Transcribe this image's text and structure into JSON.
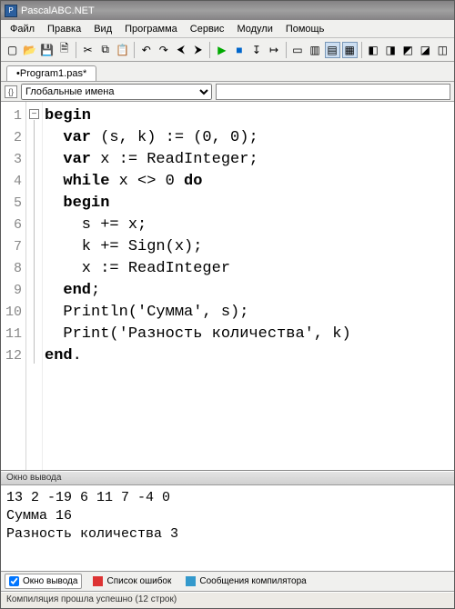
{
  "title": "PascalABC.NET",
  "menu": [
    "Файл",
    "Правка",
    "Вид",
    "Программа",
    "Сервис",
    "Модули",
    "Помощь"
  ],
  "tab": {
    "label": "•Program1.pas*"
  },
  "scope": {
    "selected": "Глобальные имена",
    "search": ""
  },
  "code": {
    "lines": [
      "begin",
      "  var (s, k) := (0, 0);",
      "  var x := ReadInteger;",
      "  while x <> 0 do",
      "  begin",
      "    s += x;",
      "    k += Sign(x);",
      "    x := ReadInteger",
      "  end;",
      "  Println('Сумма', s);",
      "  Print('Разность количества', k)",
      "end."
    ]
  },
  "output": {
    "title": "Окно вывода",
    "lines": [
      "13 2 -19 6 11 7 -4 0",
      "Сумма 16",
      "Разность количества 3"
    ]
  },
  "bottomTabs": [
    "Окно вывода",
    "Список ошибок",
    "Сообщения компилятора"
  ],
  "status": "Компиляция прошла успешно (12 строк)",
  "icons": {
    "new": "▢",
    "open": "📂",
    "save": "💾",
    "saveall": "🗎",
    "cut": "✂",
    "copy": "⧉",
    "paste": "📋",
    "undo": "↶",
    "redo": "↷",
    "back": "⮜",
    "fwd": "⮞",
    "run": "▶",
    "stop": "■",
    "stepinto": "↧",
    "stepover": "↦",
    "b1": "▭",
    "b2": "▥",
    "b3": "▤",
    "b4": "▦",
    "c1": "◧",
    "c2": "◨",
    "c3": "◩",
    "c4": "◪",
    "c5": "◫"
  }
}
